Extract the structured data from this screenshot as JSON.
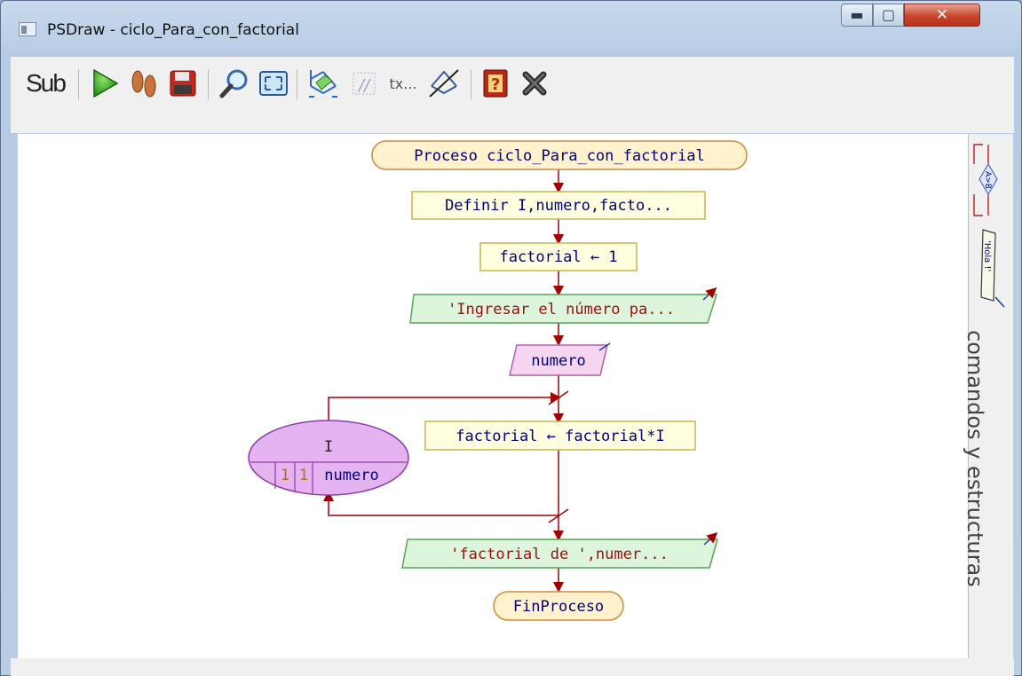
{
  "window": {
    "title": "PSDraw - ciclo_Para_con_factorial",
    "min_label": "▬",
    "max_label": "▢",
    "close_label": "✕"
  },
  "toolbar": {
    "sub_label": "Sub",
    "text_tool_label": "tx..."
  },
  "flowchart": {
    "start": "Proceso ciclo_Para_con_factorial",
    "define": "Definir I,numero,facto...",
    "assign1": "factorial ← 1",
    "output1": "'Ingresar el número pa...",
    "input1": "numero",
    "loop_var": "I",
    "loop_start": "1",
    "loop_step": "1",
    "loop_end": "numero",
    "assign2": "factorial ← factorial*I",
    "output2": "'factorial  de ',numer...",
    "end": "FinProceso"
  },
  "side_panel": {
    "label": "comandos y estructuras",
    "decision_text": "A>B",
    "output_text": "'Hola !'"
  },
  "colors": {
    "terminal_fill": "#fff2cc",
    "terminal_stroke": "#d08a3c",
    "process_fill": "#ffffe0",
    "process_stroke": "#c8b450",
    "output_fill": "#dcf5dc",
    "output_stroke": "#58a458",
    "input_fill": "#f5d5f0",
    "input_stroke": "#b45ca8",
    "loop_fill": "#e5b4f0",
    "connector": "#a00000",
    "text_dark": "#00007a",
    "text_red": "#9a1010"
  }
}
